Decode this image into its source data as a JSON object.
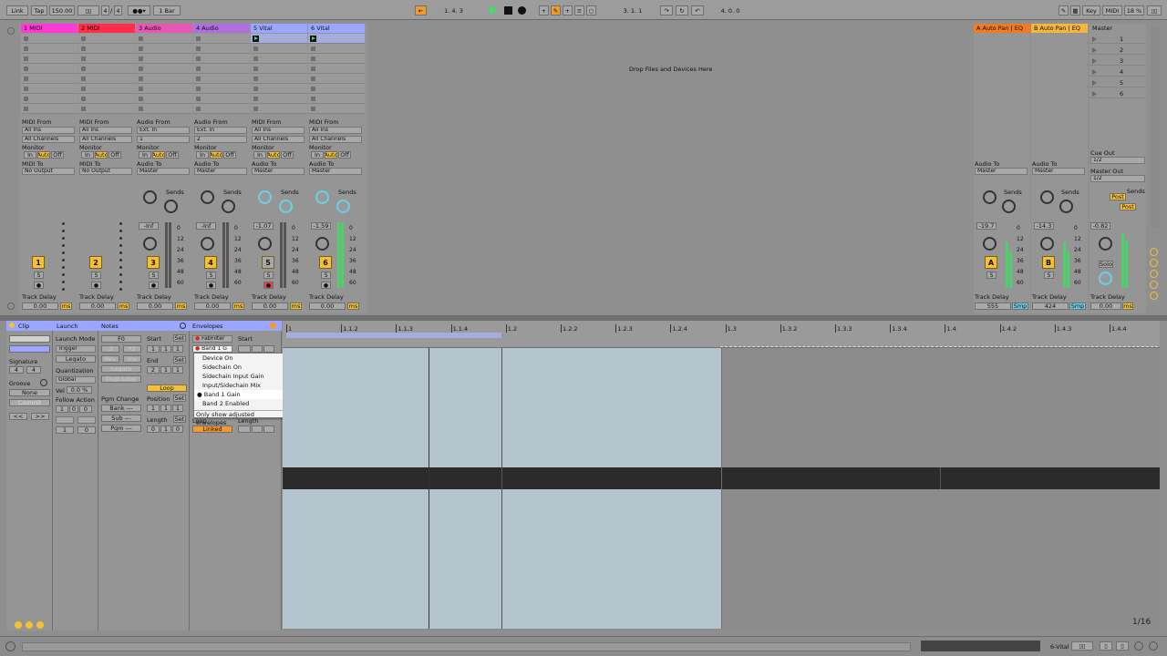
{
  "topbar": {
    "link": "Link",
    "tap": "Tap",
    "tempo": "150.00",
    "time_sig_num": "4",
    "time_sig_den": "4",
    "quantize": "1 Bar",
    "position": "1.   4.   3",
    "loop_start": "3.   1.   1",
    "loop_length": "4.   0.   0",
    "key": "Key",
    "midi": "MIDI",
    "cpu": "18 %"
  },
  "tracks": [
    {
      "name": "1 MIDI",
      "color": "#ff39d4",
      "number": "1",
      "from_label": "MIDI From",
      "from_value": "All Ins",
      "channel": "All Channels",
      "out_label": "MIDI To",
      "out_value": "No Output",
      "delay_label": "Track Delay",
      "delay_value": "0.00",
      "delay_unit": "ms"
    },
    {
      "name": "2 MIDI",
      "color": "#ff2d4a",
      "number": "2",
      "from_label": "MIDI From",
      "from_value": "All Ins",
      "channel": "All Channels",
      "out_label": "MIDI To",
      "out_value": "No Output",
      "delay_label": "Track Delay",
      "delay_value": "0.00",
      "delay_unit": "ms"
    },
    {
      "name": "3 Audio",
      "color": "#e856b6",
      "number": "3",
      "from_label": "Audio From",
      "from_value": "Ext. In",
      "channel": "1",
      "out_label": "Audio To",
      "out_value": "Master",
      "volume": "-Inf",
      "delay_label": "Track Delay",
      "delay_value": "0.00",
      "delay_unit": "ms"
    },
    {
      "name": "4 Audio",
      "color": "#b06fe0",
      "number": "4",
      "from_label": "Audio From",
      "from_value": "Ext. In",
      "channel": "2",
      "out_label": "Audio To",
      "out_value": "Master",
      "volume": "-Inf",
      "delay_label": "Track Delay",
      "delay_value": "0.00",
      "delay_unit": "ms"
    },
    {
      "name": "5 Vital",
      "color": "#9aa6ff",
      "number": "5",
      "from_label": "MIDI From",
      "from_value": "All Ins",
      "channel": "All Channels",
      "out_label": "Audio To",
      "out_value": "Master",
      "volume": "-1.07",
      "delay_label": "Track Delay",
      "delay_value": "0.00",
      "delay_unit": "ms"
    },
    {
      "name": "6 Vital",
      "color": "#9aa6ff",
      "number": "6",
      "from_label": "MIDI From",
      "from_value": "All Ins",
      "channel": "All Channels",
      "out_label": "Audio To",
      "out_value": "Master",
      "volume": "-1.59",
      "delay_label": "Track Delay",
      "delay_value": "0.00",
      "delay_unit": "ms"
    }
  ],
  "monitor": {
    "label": "Monitor",
    "in": "In",
    "auto": "Auto",
    "off": "Off"
  },
  "sends_label": "Sends",
  "meter_scale": [
    "0",
    "12",
    "24",
    "36",
    "48",
    "60"
  ],
  "drop_hint": "Drop Files and Devices Here",
  "returns": [
    {
      "name": "A Auto Pan | EQ",
      "color": "#f07b23",
      "letter": "A",
      "out_label": "Audio To",
      "out_value": "Master",
      "volume": "-19.7",
      "delay_label": "Track Delay",
      "delay_value": "555",
      "delay_unit": "Smp"
    },
    {
      "name": "B Auto Pan | EQ",
      "color": "#f5b640",
      "letter": "B",
      "out_label": "Audio To",
      "out_value": "Master",
      "volume": "-14.3",
      "delay_label": "Track Delay",
      "delay_value": "424",
      "delay_unit": "Smp"
    }
  ],
  "master": {
    "name": "Master",
    "color": "#f5b640",
    "scenes": [
      "1",
      "2",
      "3",
      "4",
      "5",
      "6"
    ],
    "cue_out_label": "Cue Out",
    "cue_out_value": "1/2",
    "master_out_label": "Master Out",
    "master_out_value": "1/2",
    "post": "Post",
    "volume": "-0.82",
    "solo": "Solo",
    "delay_label": "Track Delay",
    "delay_value": "0.00",
    "delay_unit": "ms"
  },
  "clip_panel": {
    "title": "Clip",
    "signature_label": "Signature",
    "sig_num": "4",
    "sig_den": "4",
    "groove_label": "Groove",
    "groove_value": "None",
    "commit": "Commit",
    "prev": "<<",
    "next": ">>"
  },
  "launch_panel": {
    "title": "Launch",
    "mode_label": "Launch Mode",
    "mode_value": "Trigger",
    "legato": "Legato",
    "quant_label": "Quantization",
    "quant_value": "Global",
    "vel_label": "Vel",
    "vel_value": "0.0 %",
    "follow_label": "Follow Action",
    "fa_val1": "1",
    "fa_val2": "0",
    "fa_val3": "0",
    "fa_val4": "1",
    "fa_val5": "0"
  },
  "notes_panel": {
    "title": "Notes",
    "note_value": "F0",
    "rev": "Rev",
    "inv": "Inv",
    "legato": "Legato",
    "dupl": "Dupl.Loop",
    "pgm_change_label": "Pgm Change",
    "bank": "Bank ---",
    "sub": "Sub ---",
    "pgm": "Pgm ---",
    "start_label": "Start",
    "end_label": "End",
    "set": "Set",
    "loop": "Loop",
    "position_label": "Position",
    "length_label": "Length",
    "start_v1": "1",
    "start_v2": "1",
    "start_v3": "1",
    "end_v1": "2",
    "end_v2": "1",
    "end_v3": "1",
    "pos_v1": "1",
    "pos_v2": "1",
    "pos_v3": "1",
    "len_v1": "0",
    "len_v2": "1",
    "len_v3": "0"
  },
  "envelopes_panel": {
    "title": "Envelopes",
    "device": "FabFilter",
    "control": "Band 1 G",
    "start_label": "Start",
    "loop_label": "Loop",
    "length_label": "Length",
    "linked": "Linked"
  },
  "dropdown_menu": {
    "items": [
      "Device On",
      "Sidechain On",
      "Sidechain Input Gain",
      "Input/Sidechain Mix",
      "Band 1 Gain",
      "Band 2 Enabled"
    ],
    "selected": "Band 1 Gain",
    "footer": "Only show adjusted envelopes"
  },
  "ruler": {
    "labels": [
      "1",
      "1.1.2",
      "1.1.3",
      "1.1.4",
      "1.2",
      "1.2.2",
      "1.2.3",
      "1.2.4",
      "1.3",
      "1.3.2",
      "1.3.3",
      "1.3.4",
      "1.4",
      "1.4.2",
      "1.4.3",
      "1.4.4"
    ]
  },
  "grid_label": "1/16",
  "statusbar": {
    "track": "6-Vital"
  },
  "colors": {
    "accent": "#f5c133",
    "play": "#3fe06a",
    "clip_region": "#b4c4cc",
    "menu_sel": "#ffffff"
  }
}
